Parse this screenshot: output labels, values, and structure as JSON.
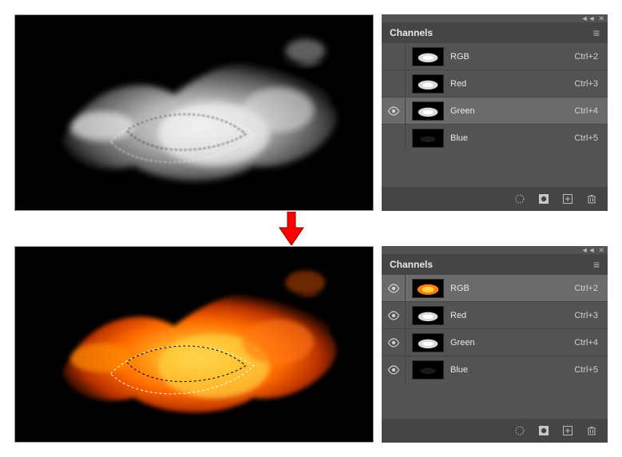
{
  "panel_title": "Channels",
  "top_bar": {
    "collapse_glyph": "◄◄",
    "close_glyph": "✕"
  },
  "panel_menu_glyph": "≡",
  "channels_top": {
    "selected_index": 2,
    "items": [
      {
        "eye_visible": false,
        "label": "RGB",
        "shortcut": "Ctrl+2",
        "thumb_style": "gray"
      },
      {
        "eye_visible": false,
        "label": "Red",
        "shortcut": "Ctrl+3",
        "thumb_style": "gray"
      },
      {
        "eye_visible": true,
        "label": "Green",
        "shortcut": "Ctrl+4",
        "thumb_style": "gray"
      },
      {
        "eye_visible": false,
        "label": "Blue",
        "shortcut": "Ctrl+5",
        "thumb_style": "dark"
      }
    ]
  },
  "channels_bottom": {
    "selected_index": 0,
    "items": [
      {
        "eye_visible": true,
        "label": "RGB",
        "shortcut": "Ctrl+2",
        "thumb_style": "fire"
      },
      {
        "eye_visible": true,
        "label": "Red",
        "shortcut": "Ctrl+3",
        "thumb_style": "gray"
      },
      {
        "eye_visible": true,
        "label": "Green",
        "shortcut": "Ctrl+4",
        "thumb_style": "gray"
      },
      {
        "eye_visible": true,
        "label": "Blue",
        "shortcut": "Ctrl+5",
        "thumb_style": "dark"
      }
    ]
  },
  "footer_icons": {
    "load_selection": "load-selection-icon",
    "save_selection_mask": "save-selection-mask-icon",
    "new_channel": "new-channel-icon",
    "delete_channel": "delete-channel-icon"
  },
  "arrow_name": "down-arrow",
  "preview_top_name": "canvas-grayscale-smoke",
  "preview_bottom_name": "canvas-colored-fire"
}
